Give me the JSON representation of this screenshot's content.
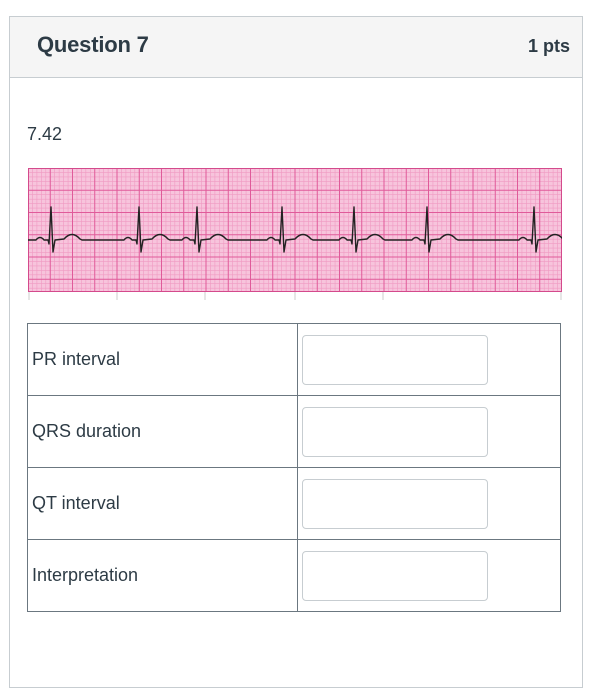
{
  "question": {
    "title": "Question 7",
    "points": "1 pts",
    "number_text": "7.42"
  },
  "ecg_image": {
    "grid_color": "#e870a8",
    "background_color": "#f7c4dc",
    "trace_color": "#222222"
  },
  "table": {
    "rows": [
      {
        "label": "PR interval",
        "value": ""
      },
      {
        "label": "QRS duration",
        "value": ""
      },
      {
        "label": "QT interval",
        "value": ""
      },
      {
        "label": "Interpretation",
        "value": ""
      }
    ]
  }
}
